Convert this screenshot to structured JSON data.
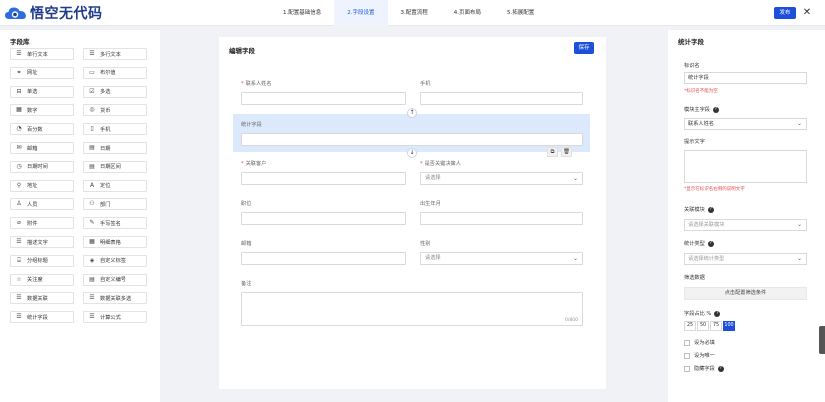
{
  "brand": {
    "name": "悟空无代码"
  },
  "steps": [
    {
      "label": "1.配置基础信息",
      "active": false
    },
    {
      "label": "2.字段设置",
      "active": true
    },
    {
      "label": "3.配置流程",
      "active": false
    },
    {
      "label": "4.页面布局",
      "active": false
    },
    {
      "label": "5.拓展配置",
      "active": false
    }
  ],
  "topbar": {
    "publish_label": "发布",
    "close_glyph": "✕"
  },
  "library": {
    "title": "字段库",
    "items": [
      {
        "label": "单行文本",
        "icon": "text-icon",
        "glyph": "☰"
      },
      {
        "label": "多行文本",
        "icon": "multiline-icon",
        "glyph": "☰"
      },
      {
        "label": "网址",
        "icon": "link-icon",
        "glyph": "⚭"
      },
      {
        "label": "布尔值",
        "icon": "boolean-icon",
        "glyph": "▭"
      },
      {
        "label": "单选",
        "icon": "radio-icon",
        "glyph": "⊟"
      },
      {
        "label": "多选",
        "icon": "checkbox-icon",
        "glyph": "☑"
      },
      {
        "label": "数字",
        "icon": "number-icon",
        "glyph": "▦"
      },
      {
        "label": "货币",
        "icon": "currency-icon",
        "glyph": "◎"
      },
      {
        "label": "百分数",
        "icon": "percent-icon",
        "glyph": "◔"
      },
      {
        "label": "手机",
        "icon": "phone-icon",
        "glyph": "▯"
      },
      {
        "label": "邮箱",
        "icon": "mail-icon",
        "glyph": "✉"
      },
      {
        "label": "日期",
        "icon": "date-icon",
        "glyph": "▤"
      },
      {
        "label": "日期时间",
        "icon": "datetime-icon",
        "glyph": "◷"
      },
      {
        "label": "日期区间",
        "icon": "date-range-icon",
        "glyph": "▤"
      },
      {
        "label": "地址",
        "icon": "address-icon",
        "glyph": "⚲"
      },
      {
        "label": "定位",
        "icon": "location-icon",
        "glyph": "A"
      },
      {
        "label": "人员",
        "icon": "user-icon",
        "glyph": "♙"
      },
      {
        "label": "部门",
        "icon": "department-icon",
        "glyph": "⚇"
      },
      {
        "label": "附件",
        "icon": "attachment-icon",
        "glyph": "⌀"
      },
      {
        "label": "手写签名",
        "icon": "signature-icon",
        "glyph": "✎"
      },
      {
        "label": "描述文字",
        "icon": "description-icon",
        "glyph": "☰"
      },
      {
        "label": "明细表格",
        "icon": "table-icon",
        "glyph": "▦"
      },
      {
        "label": "分组标题",
        "icon": "group-title-icon",
        "glyph": "⌹"
      },
      {
        "label": "自定义标签",
        "icon": "tag-icon",
        "glyph": "◈"
      },
      {
        "label": "关注度",
        "icon": "star-icon",
        "glyph": "☆"
      },
      {
        "label": "自定义编号",
        "icon": "serial-icon",
        "glyph": "▤"
      },
      {
        "label": "数据关联",
        "icon": "relation-icon",
        "glyph": "☰"
      },
      {
        "label": "数据关联多选",
        "icon": "relation-multi-icon",
        "glyph": "☰"
      },
      {
        "label": "统计字段",
        "icon": "statistic-icon",
        "glyph": "☰"
      },
      {
        "label": "计算公式",
        "icon": "formula-icon",
        "glyph": "☰"
      }
    ]
  },
  "editor": {
    "title": "编辑字段",
    "save_label": "保存",
    "required_mark": "*",
    "fields": {
      "contact_name": {
        "label": "联系人姓名",
        "required": true
      },
      "phone": {
        "label": "手机"
      },
      "statistic": {
        "label": "统计字段"
      },
      "customer": {
        "label": "关联客户",
        "required": true
      },
      "key_decider": {
        "label": "是否关键决策人",
        "required": true,
        "placeholder": "请选择"
      },
      "position": {
        "label": "职位"
      },
      "birth": {
        "label": "出生年月"
      },
      "email": {
        "label": "邮箱"
      },
      "gender": {
        "label": "性别",
        "placeholder": "请选择"
      },
      "remark": {
        "label": "备注",
        "counter": "0/800"
      }
    },
    "up_glyph": "↑",
    "down_glyph": "↓",
    "copy_glyph": "⧉",
    "delete_glyph": "🗑",
    "chevron": "⌄"
  },
  "props": {
    "title": "统计字段",
    "id_label": "标识名",
    "id_value": "统计字段",
    "id_hint": "*标识名不能为空",
    "module_field_label": "模块主字段",
    "module_field_value": "联系人姓名",
    "prompt_label": "提示文字",
    "prompt_hint": "*显示在标识名右侧的说明文字",
    "relation_label": "关联模块",
    "relation_placeholder": "请选择关联模块",
    "stat_type_label": "统计类型",
    "stat_type_placeholder": "请选择统计类型",
    "filter_label": "筛选数据",
    "filter_button": "点击配置筛选条件",
    "ratio_label": "字段占比 %",
    "ratio_options": [
      "25",
      "50",
      "75",
      "100"
    ],
    "ratio_active": "100",
    "checks": [
      {
        "label": "设为必填",
        "help": false
      },
      {
        "label": "设为唯一",
        "help": false
      },
      {
        "label": "隐藏字段",
        "help": true
      }
    ],
    "help_glyph": "?",
    "chevron": "⌄"
  }
}
